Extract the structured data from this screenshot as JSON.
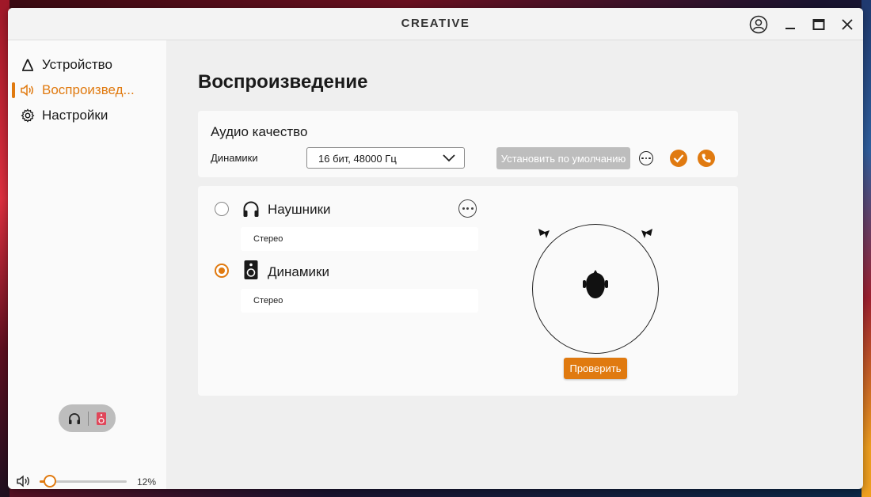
{
  "window": {
    "brand": "CREATIVE"
  },
  "sidebar": {
    "items": [
      {
        "label": "Устройство",
        "icon": "delta-icon",
        "active": false
      },
      {
        "label": "Воспроизвед...",
        "icon": "speaker-volume-icon",
        "active": true
      },
      {
        "label": "Настройки",
        "icon": "gear-icon",
        "active": false
      }
    ],
    "volume": {
      "percent_label": "12%",
      "value": 0.12
    }
  },
  "main": {
    "title": "Воспроизведение",
    "quality": {
      "title": "Аудио качество",
      "device_label": "Динамики",
      "format_value": "16 бит, 48000 Гц",
      "set_default_label": "Установить по умолчанию"
    },
    "outputs": [
      {
        "name": "Наушники",
        "mode": "Стерео",
        "selected": false,
        "icon": "headphones-icon"
      },
      {
        "name": "Динамики",
        "mode": "Стерео",
        "selected": true,
        "icon": "speaker-icon"
      }
    ],
    "test_label": "Проверить"
  },
  "colors": {
    "accent": "#e07a10",
    "disabled": "#bdbdbd"
  }
}
